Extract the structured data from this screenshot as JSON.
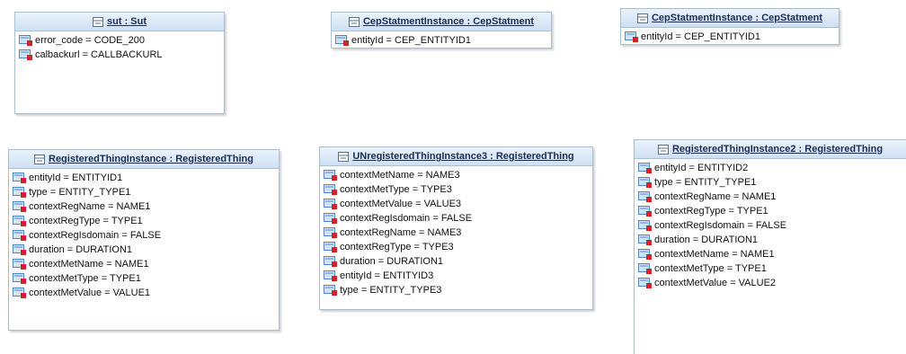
{
  "boxes": [
    {
      "title": "sut : Sut",
      "attributes": [
        "error_code = CODE_200",
        "calbackurl = CALLBACKURL"
      ]
    },
    {
      "title": "CepStatmentInstance : CepStatment",
      "attributes": [
        "entityId = CEP_ENTITYID1"
      ]
    },
    {
      "title": "CepStatmentInstance : CepStatment",
      "attributes": [
        "entityId = CEP_ENTITYID1"
      ]
    },
    {
      "title": "RegisteredThingInstance : RegisteredThing",
      "attributes": [
        "entityId = ENTITYID1",
        "type = ENTITY_TYPE1",
        "contextRegName = NAME1",
        "contextRegType = TYPE1",
        "contextRegIsdomain = FALSE",
        "duration = DURATION1",
        "contextMetName = NAME1",
        "contextMetType = TYPE1",
        "contextMetValue = VALUE1"
      ]
    },
    {
      "title": "UNregisteredThingInstance3 : RegisteredThing",
      "attributes": [
        "contextMetName = NAME3",
        "contextMetType = TYPE3",
        "contextMetValue = VALUE3",
        "contextRegIsdomain = FALSE",
        "contextRegName = NAME3",
        "contextRegType = TYPE3",
        "duration = DURATION1",
        "entityId = ENTITYID3",
        "type = ENTITY_TYPE3"
      ]
    },
    {
      "title": "RegisteredThingInstance2 : RegisteredThing",
      "attributes": [
        "entityId = ENTITYID2",
        "type = ENTITY_TYPE1",
        "contextRegName = NAME1",
        "contextRegType = TYPE1",
        "contextRegIsdomain = FALSE",
        "duration = DURATION1",
        "contextMetName = NAME1",
        "contextMetType = TYPE1",
        "contextMetValue = VALUE2"
      ]
    }
  ],
  "icons": {
    "class": "uml-instance-icon",
    "attribute": "attribute-slot-icon"
  },
  "colors": {
    "border": "#a9bfd6",
    "header_top": "#e9f2fb",
    "header_bottom": "#cfe0f3",
    "title_text": "#1b2d55",
    "attr_icon_blue": "#4f86c6",
    "attr_icon_red": "#d6202a"
  }
}
